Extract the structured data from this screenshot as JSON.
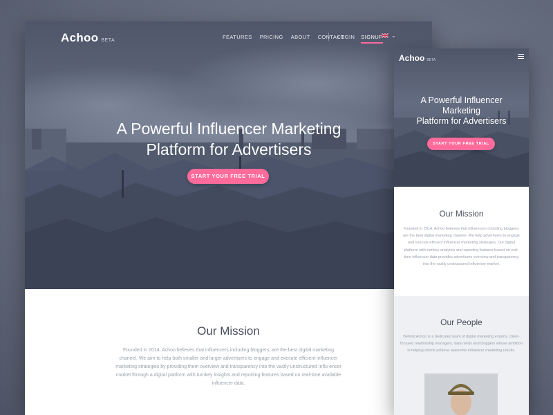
{
  "brand_color": "#ff6b9b",
  "desktop": {
    "nav": {
      "logo": "Achoo",
      "beta": "BETA",
      "menu": [
        "FEATURES",
        "PRICING",
        "ABOUT",
        "CONTACT"
      ],
      "login": "LOGIN",
      "signup": "SIGNUP",
      "language_icon": "uk-flag-icon"
    },
    "hero": {
      "title_line1": "A Powerful Influencer Marketing",
      "title_line2": "Platform for Advertisers",
      "cta": "START YOUR FREE TRIAL"
    },
    "mission": {
      "title": "Our Mission",
      "text": "Founded in 2014, Achoo believes that influencers including bloggers, are the best digital marketing channel. We aim to help both smaller and larger advertisers to engage and execute efficient influencer marketing strategies by providing them overview and transparency into the vastly unstructured Influ-encer market through a digital platform with turnkey insights and reporting features based on real-time available influencer data."
    }
  },
  "mobile": {
    "nav": {
      "logo": "Achoo",
      "beta": "BETA",
      "menu_icon": "hamburger-icon"
    },
    "hero": {
      "title_line1": "A Powerful Influencer",
      "title_line2": "Marketing",
      "title_line3": "Platform for Advertisers",
      "cta": "START YOUR FREE TRIAL"
    },
    "mission": {
      "title": "Our Mission",
      "text": "Founded in 2014, Achoo believes that influencers including bloggers, are the best digital marketing channel. We help advertisers to engage and execute efficient influencer marketing strategies. Our digital platform with turnkey analytics and reporting features based on real-time influencer data provides advertisers overview and transparency into the vastly unstructured influencer market."
    },
    "people": {
      "title": "Our People",
      "text": "Behind Achoo is a dedicated team of digital marketing experts, client-focused relationship managers, data nerds and bloggers whose ambition is helping clients achieve awesome influencer marketing results."
    }
  }
}
